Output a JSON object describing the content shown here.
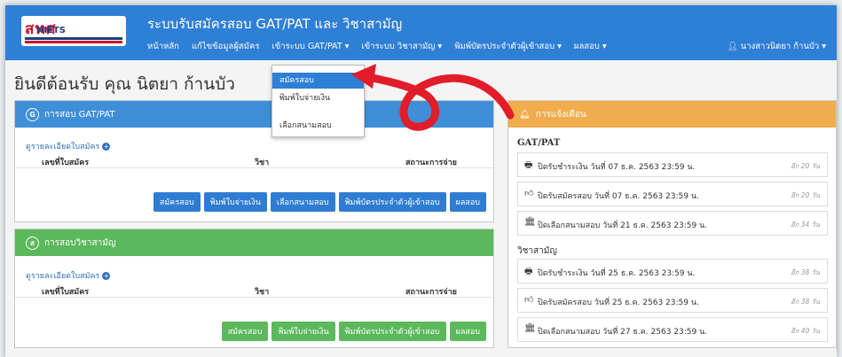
{
  "logo": {
    "thai": "สทศ",
    "abbr": "NIETS"
  },
  "site_title": "ระบบรับสมัครสอบ GAT/PAT และ วิชาสามัญ",
  "nav": {
    "home": "หน้าหลัก",
    "edit_profile": "แก้ไขข้อมูลผู้สมัคร",
    "gatpat_menu": "เข้าระบบ GAT/PAT ▾",
    "common_menu": "เข้าระบบ วิชาสามัญ ▾",
    "print_card": "พิมพ์บัตรประจำตัวผู้เข้าสอบ ▾",
    "results": "ผลสอบ ▾",
    "user": "นางสาวนิตยา ก้านบัว ▾"
  },
  "welcome": "ยินดีต้อนรับ คุณ นิตยา ก้านบัว",
  "dropdown": {
    "items": [
      "สมัครสอบ",
      "พิมพ์ใบจ่ายเงิน",
      "เลือกสนามสอบ"
    ]
  },
  "gatpat_panel": {
    "title": "การสอบ GAT/PAT",
    "icon_letter": "G",
    "detail_link": "ดูรายละเอียดใบสมัคร",
    "headers": {
      "no": "เลขที่ใบสมัคร",
      "subject": "วิชา",
      "status": "สถานะการจ่าย"
    },
    "buttons": {
      "apply": "สมัครสอบ",
      "print_payment": "พิมพ์ใบจ่ายเงิน",
      "choose_center": "เลือกสนามสอบ",
      "print_card": "พิมพ์บัตรประจำตัวผู้เข้าสอบ",
      "results": "ผลสอบ"
    }
  },
  "common_panel": {
    "title": "การสอบวิชาสามัญ",
    "icon_letter": "ส",
    "detail_link": "ดูรายละเอียดใบสมัคร",
    "headers": {
      "no": "เลขที่ใบสมัคร",
      "subject": "วิชา",
      "status": "สถานะการจ่าย"
    },
    "buttons": {
      "apply": "สมัครสอบ",
      "print_payment": "พิมพ์ใบจ่ายเงิน",
      "print_card": "พิมพ์บัตรประจำตัวผู้เข้าสอบ",
      "results": "ผลสอบ"
    }
  },
  "notifications": {
    "title": "การแจ้งเตือน",
    "gatpat_title": "GAT/PAT",
    "common_title": "วิชาสามัญ",
    "gatpat_items": [
      {
        "icon": "printer-icon",
        "text": "ปิดรับชำระเงิน วันที่ 07 ธ.ค. 2563 23:59 น.",
        "ago": "อีก 20 วัน"
      },
      {
        "icon": "thumbs-up-icon",
        "text": "ปิดรับสมัครสอบ วันที่ 07 ธ.ค. 2563 23:59 น.",
        "ago": "อีก 20 วัน"
      },
      {
        "icon": "building-icon",
        "text": "ปิดเลือกสนามสอบ วันที่ 21 ธ.ค. 2563 23:59 น.",
        "ago": "อีก 34 วัน"
      }
    ],
    "common_items": [
      {
        "icon": "printer-icon",
        "text": "ปิดรับชำระเงิน วันที่ 25 ธ.ค. 2563 23:59 น.",
        "ago": "อีก 38 วัน"
      },
      {
        "icon": "thumbs-up-icon",
        "text": "ปิดรับสมัครสอบ วันที่ 25 ธ.ค. 2563 23:59 น.",
        "ago": "อีก 38 วัน"
      },
      {
        "icon": "building-icon",
        "text": "ปิดเลือกสนามสอบ วันที่ 27 ธ.ค. 2563 23:59 น.",
        "ago": "อีก 40 วัน"
      }
    ]
  },
  "colors": {
    "navbar": "#2e7fd6",
    "blue_panel": "#3f8fd8",
    "green_panel": "#5cb85c",
    "orange_panel": "#f0ad4e",
    "annotation_arrow": "#e11d2a"
  }
}
